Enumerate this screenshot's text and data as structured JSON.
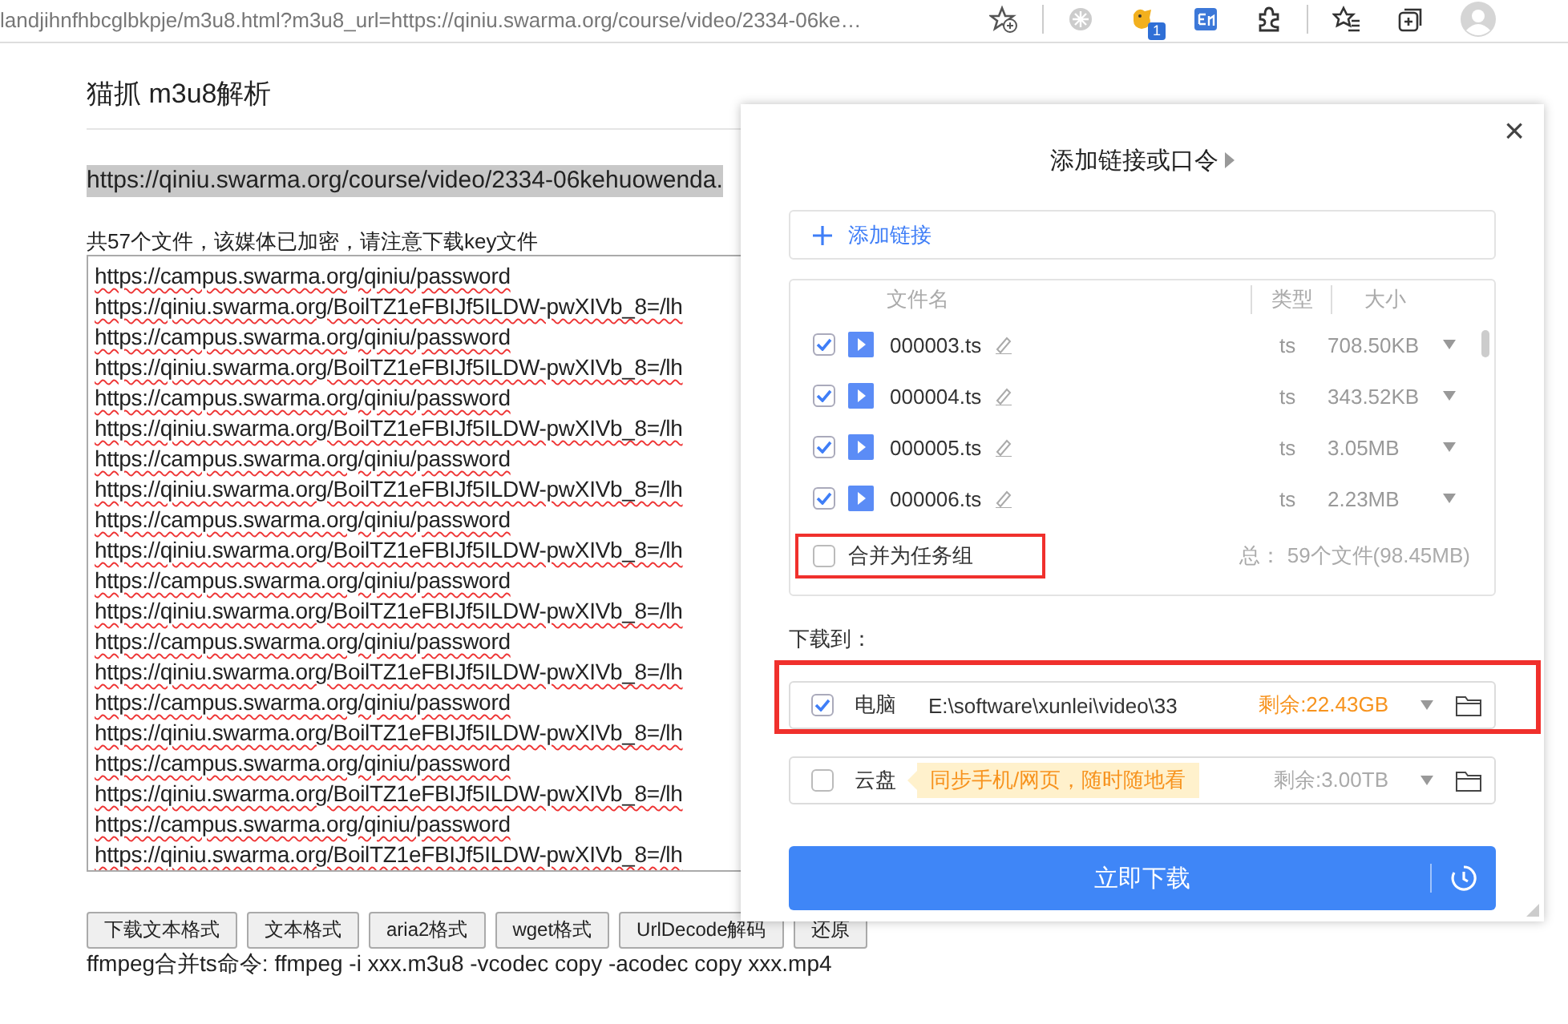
{
  "browser": {
    "address": "landjihnfhbcglbkpje/m3u8.html?m3u8_url=https://qiniu.swarma.org/course/video/2334-06ke…",
    "extension_badge": "1"
  },
  "page": {
    "title": "猫抓 m3u8解析",
    "source_url": "https://qiniu.swarma.org/course/video/2334-06kehuowenda.",
    "summary": "共57个文件，该媒体已加密，请注意下载key文件",
    "lines": [
      "https://campus.swarma.org/qiniu/password",
      "https://qiniu.swarma.org/BoilTZ1eFBIJf5ILDW-pwXIVb_8=/lh",
      "https://campus.swarma.org/qiniu/password",
      "https://qiniu.swarma.org/BoilTZ1eFBIJf5ILDW-pwXIVb_8=/lh",
      "https://campus.swarma.org/qiniu/password",
      "https://qiniu.swarma.org/BoilTZ1eFBIJf5ILDW-pwXIVb_8=/lh",
      "https://campus.swarma.org/qiniu/password",
      "https://qiniu.swarma.org/BoilTZ1eFBIJf5ILDW-pwXIVb_8=/lh",
      "https://campus.swarma.org/qiniu/password",
      "https://qiniu.swarma.org/BoilTZ1eFBIJf5ILDW-pwXIVb_8=/lh",
      "https://campus.swarma.org/qiniu/password",
      "https://qiniu.swarma.org/BoilTZ1eFBIJf5ILDW-pwXIVb_8=/lh",
      "https://campus.swarma.org/qiniu/password",
      "https://qiniu.swarma.org/BoilTZ1eFBIJf5ILDW-pwXIVb_8=/lh",
      "https://campus.swarma.org/qiniu/password",
      "https://qiniu.swarma.org/BoilTZ1eFBIJf5ILDW-pwXIVb_8=/lh",
      "https://campus.swarma.org/qiniu/password",
      "https://qiniu.swarma.org/BoilTZ1eFBIJf5ILDW-pwXIVb_8=/lh",
      "https://campus.swarma.org/qiniu/password",
      "https://qiniu.swarma.org/BoilTZ1eFBIJf5ILDW-pwXIVb_8=/lh"
    ],
    "buttons": [
      "下载文本格式",
      "文本格式",
      "aria2格式",
      "wget格式",
      "UrlDecode解码",
      "还原"
    ],
    "ffmpeg_hint": "ffmpeg合并ts命令: ffmpeg -i xxx.m3u8 -vcodec copy -acodec copy xxx.mp4"
  },
  "dialog": {
    "title": "添加链接或口令",
    "close": "×",
    "add_link": "添加链接",
    "columns": [
      "文件名",
      "类型",
      "大小"
    ],
    "files": [
      {
        "name": "000003.ts",
        "type": "ts",
        "size": "708.50KB",
        "checked": true
      },
      {
        "name": "000004.ts",
        "type": "ts",
        "size": "343.52KB",
        "checked": true
      },
      {
        "name": "000005.ts",
        "type": "ts",
        "size": "3.05MB",
        "checked": true
      },
      {
        "name": "000006.ts",
        "type": "ts",
        "size": "2.23MB",
        "checked": true
      }
    ],
    "merge": {
      "label": "合并为任务组",
      "checked": false,
      "highlighted": true
    },
    "total_label": "总：",
    "total": "59个文件(98.45MB)",
    "download_to": "下载到：",
    "destinations": [
      {
        "name": "电脑",
        "path": "E:\\software\\xunlei\\video\\33",
        "free": "剩余:22.43GB",
        "checked": true,
        "highlighted": true
      },
      {
        "name": "云盘",
        "promo": "同步手机/网页，随时随地看",
        "free": "剩余:3.00TB",
        "checked": false,
        "highlighted": false
      }
    ],
    "download_button": "立即下载"
  }
}
